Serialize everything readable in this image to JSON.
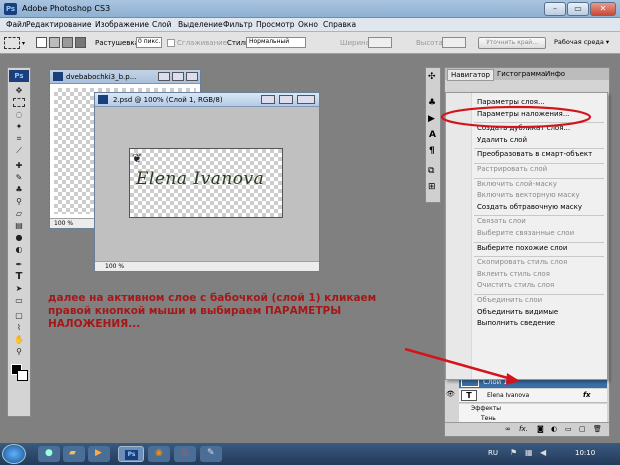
{
  "app": {
    "title": "Adobe Photoshop CS3",
    "logo": "Ps"
  },
  "window_controls": {
    "minimize": "–",
    "maximize": "▭",
    "close": "✕"
  },
  "menu": [
    "Файл",
    "Редактирование",
    "Изображение",
    "Слой",
    "Выделение",
    "Фильтр",
    "Просмотр",
    "Окно",
    "Справка"
  ],
  "options": {
    "feather_label": "Растушевка:",
    "feather_value": "0 пикс.",
    "antialias_label": "Сглаживание",
    "style_label": "Стиль:",
    "style_value": "Нормальный",
    "width_label": "Ширина:",
    "height_label": "Высота:",
    "refine_button": "Уточнить край...",
    "workspace": "Рабочая среда ▾"
  },
  "toolbox": {
    "badge": "Ps"
  },
  "doc1": {
    "title": "dvebabochki3_b.p...",
    "zoom": "100 %"
  },
  "doc2": {
    "title": "2.psd @ 100% (Слой 1, RGB/8)",
    "zoom": "100 %",
    "text": "Elena Ivanova"
  },
  "panels": {
    "tabs": [
      "Навигатор",
      "Гистограмма",
      "Инфо"
    ]
  },
  "context_menu": [
    {
      "label": "Параметры слоя...",
      "enabled": true
    },
    {
      "label": "Параметры наложения...",
      "enabled": true,
      "highlight": true
    },
    {
      "sep": true
    },
    {
      "label": "Создать дубликат слоя...",
      "enabled": true
    },
    {
      "label": "Удалить слой",
      "enabled": true
    },
    {
      "sep": true
    },
    {
      "label": "Преобразовать в смарт-объект",
      "enabled": true
    },
    {
      "sep": true
    },
    {
      "label": "Растрировать слой",
      "enabled": false
    },
    {
      "sep": true
    },
    {
      "label": "Включить слой-маску",
      "enabled": false
    },
    {
      "label": "Включить векторную маску",
      "enabled": false
    },
    {
      "label": "Создать обтравочную маску",
      "enabled": true
    },
    {
      "sep": true
    },
    {
      "label": "Связать слои",
      "enabled": false
    },
    {
      "label": "Выберите связанные слои",
      "enabled": false
    },
    {
      "sep": true
    },
    {
      "label": "Выберите похожие слои",
      "enabled": true
    },
    {
      "sep": true
    },
    {
      "label": "Скопировать стиль слоя",
      "enabled": false
    },
    {
      "label": "Вклеить стиль слоя",
      "enabled": false
    },
    {
      "label": "Очистить стиль слоя",
      "enabled": false
    },
    {
      "sep": true
    },
    {
      "label": "Объединить слои",
      "enabled": false
    },
    {
      "label": "Объединить видимые",
      "enabled": true
    },
    {
      "label": "Выполнить сведение",
      "enabled": true
    }
  ],
  "layers": {
    "layer1": "Слой 1",
    "text_layer": "Elena Ivanova",
    "text_thumb": "T",
    "effects": "Эффекты",
    "shadow": "Тень",
    "fx": "fx"
  },
  "instruction": "далее на активном слое с бабочкой (слой 1) кликаем правой кнопкой мыши и выбираем ПАРАМЕТРЫ НАЛОЖЕНИЯ...",
  "taskbar": {
    "lang": "RU",
    "clock": "10:10"
  },
  "colors": {
    "accent": "#1b3f7a",
    "annotation": "#d4141c",
    "highlight_text": "#a51818"
  }
}
